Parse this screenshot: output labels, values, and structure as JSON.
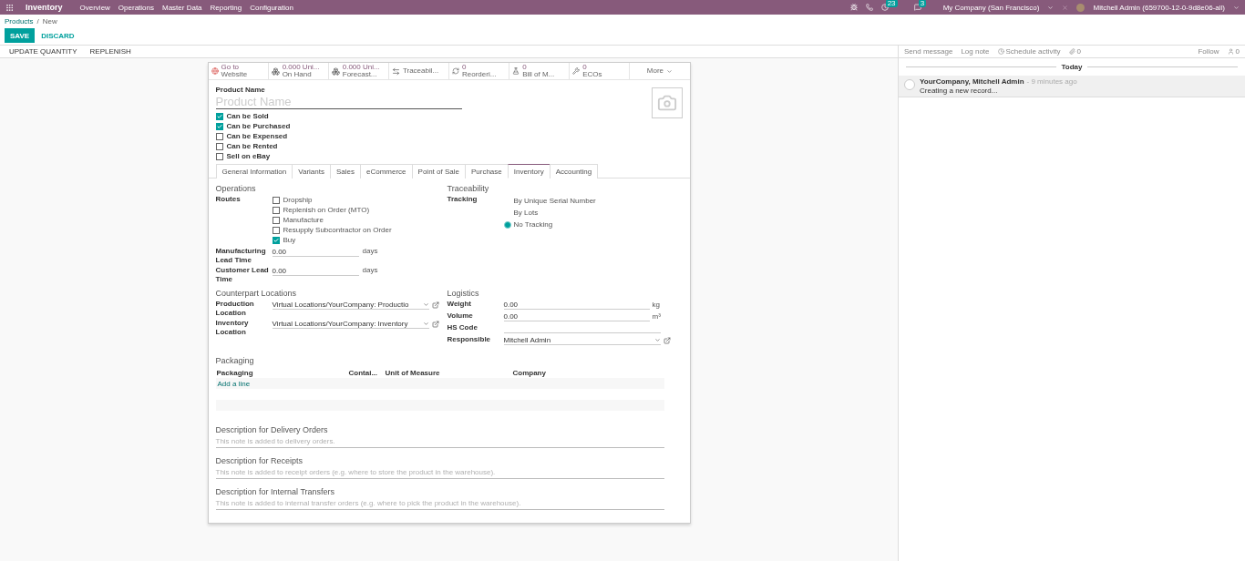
{
  "navbar": {
    "app_title": "Inventory",
    "menu": [
      "Overview",
      "Operations",
      "Master Data",
      "Reporting",
      "Configuration"
    ],
    "activity_count": "23",
    "message_count": "3",
    "company": "My Company (San Francisco)",
    "user": "Mitchell Admin (659700-12-0-9d8e06-all)"
  },
  "breadcrumb": {
    "items": [
      "Products",
      "New"
    ],
    "separator": "/"
  },
  "actions": {
    "save": "SAVE",
    "discard": "DISCARD"
  },
  "header_buttons": [
    "UPDATE QUANTITY",
    "REPLENISH"
  ],
  "smart_buttons": [
    {
      "kind": "website",
      "value": "Go to",
      "label": "Website"
    },
    {
      "kind": "onhand",
      "value": "0.000 Uni...",
      "label": "On Hand"
    },
    {
      "kind": "forecast",
      "value": "0.000 Uni...",
      "label": "Forecast..."
    },
    {
      "kind": "traceability",
      "label": "Traceabil..."
    },
    {
      "kind": "reorder",
      "value": "0",
      "label": "Reorderi..."
    },
    {
      "kind": "bom",
      "value": "0",
      "label": "Bill of M..."
    },
    {
      "kind": "eco",
      "value": "0",
      "label": "ECOs"
    },
    {
      "kind": "more",
      "label": "More"
    }
  ],
  "product_name": {
    "label": "Product Name",
    "placeholder": "Product Name"
  },
  "options": [
    {
      "label": "Can be Sold",
      "checked": true
    },
    {
      "label": "Can be Purchased",
      "checked": true
    },
    {
      "label": "Can be Expensed",
      "checked": false
    },
    {
      "label": "Can be Rented",
      "checked": false
    },
    {
      "label": "Sell on eBay",
      "checked": false
    }
  ],
  "tabs": [
    {
      "label": "General Information",
      "selected": false
    },
    {
      "label": "Variants",
      "selected": false
    },
    {
      "label": "Sales",
      "selected": false
    },
    {
      "label": "eCommerce",
      "selected": false
    },
    {
      "label": "Point of Sale",
      "selected": false
    },
    {
      "label": "Purchase",
      "selected": false
    },
    {
      "label": "Inventory",
      "selected": true
    },
    {
      "label": "Accounting",
      "selected": false
    }
  ],
  "operations": {
    "title": "Operations",
    "routes_label": "Routes",
    "routes": [
      {
        "label": "Dropship",
        "checked": false
      },
      {
        "label": "Replenish on Order (MTO)",
        "checked": false
      },
      {
        "label": "Manufacture",
        "checked": false
      },
      {
        "label": "Resupply Subcontractor on Order",
        "checked": false
      },
      {
        "label": "Buy",
        "checked": true
      }
    ],
    "lead_times": [
      {
        "label": "Manufacturing Lead Time",
        "value": "0.00",
        "unit": "days"
      },
      {
        "label": "Customer Lead Time",
        "value": "0.00",
        "unit": "days"
      }
    ]
  },
  "traceability": {
    "title": "Traceability",
    "tracking_label": "Tracking",
    "options": [
      {
        "label": "By Unique Serial Number",
        "selected": false
      },
      {
        "label": "By Lots",
        "selected": false
      },
      {
        "label": "No Tracking",
        "selected": true
      }
    ]
  },
  "counterpart_locations": {
    "title": "Counterpart Locations",
    "fields": [
      {
        "label": "Production Location",
        "value": "Virtual Locations/YourCompany: Productio"
      },
      {
        "label": "Inventory Location",
        "value": "Virtual Locations/YourCompany: Inventory"
      }
    ]
  },
  "logistics": {
    "title": "Logistics",
    "fields": [
      {
        "kind": "unit",
        "label": "Weight",
        "value": "0.00",
        "unit": "kg"
      },
      {
        "kind": "unit",
        "label": "Volume",
        "value": "0.00",
        "unit": "m³"
      },
      {
        "kind": "text",
        "label": "HS Code"
      },
      {
        "kind": "many2one",
        "label": "Responsible",
        "value": "Mitchell Admin"
      }
    ]
  },
  "packaging": {
    "title": "Packaging",
    "columns": [
      "Packaging",
      "Contai...",
      "Unit of Measure",
      "Company"
    ],
    "add_line": "Add a line"
  },
  "descriptions": [
    {
      "title": "Description for Delivery Orders",
      "placeholder": "This note is added to delivery orders."
    },
    {
      "title": "Description for Receipts",
      "placeholder": "This note is added to receipt orders (e.g. where to store the product in the warehouse)."
    },
    {
      "title": "Description for Internal Transfers",
      "placeholder": "This note is added to internal transfer orders (e.g. where to pick the product in the warehouse)."
    }
  ],
  "chatter": {
    "send_message": "Send message",
    "log_note": "Log note",
    "schedule_activity": "Schedule activity",
    "attachments": "0",
    "follow": "Follow",
    "followers": "0",
    "date_divider": "Today",
    "messages": [
      {
        "author": "YourCompany, Mitchell Admin",
        "time": "- 9 minutes ago",
        "body": "Creating a new record..."
      }
    ]
  }
}
